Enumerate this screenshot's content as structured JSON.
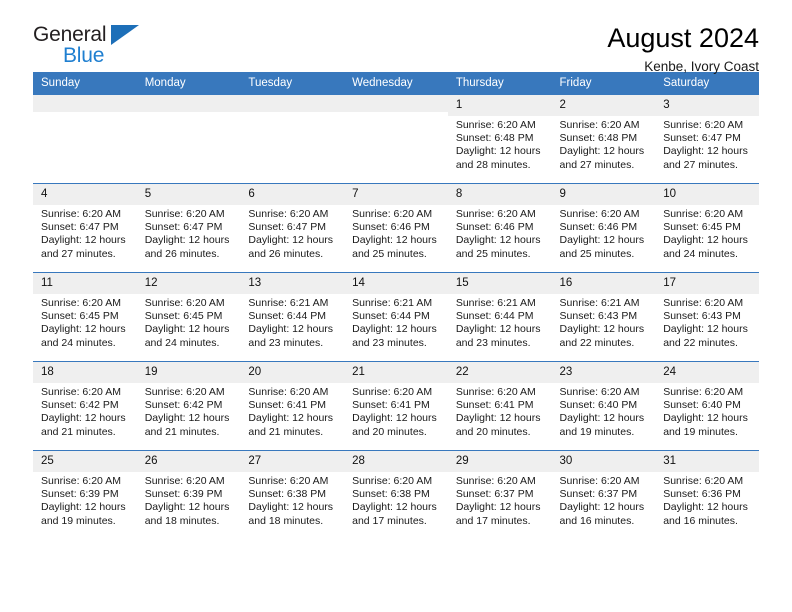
{
  "brand": {
    "line1": "General",
    "line2": "Blue",
    "triangle_color": "#1d6fb8"
  },
  "header": {
    "title": "August 2024",
    "subtitle": "Kenbe, Ivory Coast"
  },
  "colors": {
    "header_blue": "#3878bd",
    "daynum_band": "#efefef",
    "text": "#1a1a1a"
  },
  "weekdays": [
    "Sunday",
    "Monday",
    "Tuesday",
    "Wednesday",
    "Thursday",
    "Friday",
    "Saturday"
  ],
  "labels": {
    "sunrise_prefix": "Sunrise:",
    "sunset_prefix": "Sunset:",
    "daylight_prefix": "Daylight:"
  },
  "weeks": [
    [
      {
        "day": "",
        "empty": true
      },
      {
        "day": "",
        "empty": true
      },
      {
        "day": "",
        "empty": true
      },
      {
        "day": "",
        "empty": true
      },
      {
        "day": "1",
        "l1": "Sunrise: 6:20 AM",
        "l2": "Sunset: 6:48 PM",
        "l3": "Daylight: 12 hours",
        "l4": "and 28 minutes."
      },
      {
        "day": "2",
        "l1": "Sunrise: 6:20 AM",
        "l2": "Sunset: 6:48 PM",
        "l3": "Daylight: 12 hours",
        "l4": "and 27 minutes."
      },
      {
        "day": "3",
        "l1": "Sunrise: 6:20 AM",
        "l2": "Sunset: 6:47 PM",
        "l3": "Daylight: 12 hours",
        "l4": "and 27 minutes."
      }
    ],
    [
      {
        "day": "4",
        "l1": "Sunrise: 6:20 AM",
        "l2": "Sunset: 6:47 PM",
        "l3": "Daylight: 12 hours",
        "l4": "and 27 minutes."
      },
      {
        "day": "5",
        "l1": "Sunrise: 6:20 AM",
        "l2": "Sunset: 6:47 PM",
        "l3": "Daylight: 12 hours",
        "l4": "and 26 minutes."
      },
      {
        "day": "6",
        "l1": "Sunrise: 6:20 AM",
        "l2": "Sunset: 6:47 PM",
        "l3": "Daylight: 12 hours",
        "l4": "and 26 minutes."
      },
      {
        "day": "7",
        "l1": "Sunrise: 6:20 AM",
        "l2": "Sunset: 6:46 PM",
        "l3": "Daylight: 12 hours",
        "l4": "and 25 minutes."
      },
      {
        "day": "8",
        "l1": "Sunrise: 6:20 AM",
        "l2": "Sunset: 6:46 PM",
        "l3": "Daylight: 12 hours",
        "l4": "and 25 minutes."
      },
      {
        "day": "9",
        "l1": "Sunrise: 6:20 AM",
        "l2": "Sunset: 6:46 PM",
        "l3": "Daylight: 12 hours",
        "l4": "and 25 minutes."
      },
      {
        "day": "10",
        "l1": "Sunrise: 6:20 AM",
        "l2": "Sunset: 6:45 PM",
        "l3": "Daylight: 12 hours",
        "l4": "and 24 minutes."
      }
    ],
    [
      {
        "day": "11",
        "l1": "Sunrise: 6:20 AM",
        "l2": "Sunset: 6:45 PM",
        "l3": "Daylight: 12 hours",
        "l4": "and 24 minutes."
      },
      {
        "day": "12",
        "l1": "Sunrise: 6:20 AM",
        "l2": "Sunset: 6:45 PM",
        "l3": "Daylight: 12 hours",
        "l4": "and 24 minutes."
      },
      {
        "day": "13",
        "l1": "Sunrise: 6:21 AM",
        "l2": "Sunset: 6:44 PM",
        "l3": "Daylight: 12 hours",
        "l4": "and 23 minutes."
      },
      {
        "day": "14",
        "l1": "Sunrise: 6:21 AM",
        "l2": "Sunset: 6:44 PM",
        "l3": "Daylight: 12 hours",
        "l4": "and 23 minutes."
      },
      {
        "day": "15",
        "l1": "Sunrise: 6:21 AM",
        "l2": "Sunset: 6:44 PM",
        "l3": "Daylight: 12 hours",
        "l4": "and 23 minutes."
      },
      {
        "day": "16",
        "l1": "Sunrise: 6:21 AM",
        "l2": "Sunset: 6:43 PM",
        "l3": "Daylight: 12 hours",
        "l4": "and 22 minutes."
      },
      {
        "day": "17",
        "l1": "Sunrise: 6:20 AM",
        "l2": "Sunset: 6:43 PM",
        "l3": "Daylight: 12 hours",
        "l4": "and 22 minutes."
      }
    ],
    [
      {
        "day": "18",
        "l1": "Sunrise: 6:20 AM",
        "l2": "Sunset: 6:42 PM",
        "l3": "Daylight: 12 hours",
        "l4": "and 21 minutes."
      },
      {
        "day": "19",
        "l1": "Sunrise: 6:20 AM",
        "l2": "Sunset: 6:42 PM",
        "l3": "Daylight: 12 hours",
        "l4": "and 21 minutes."
      },
      {
        "day": "20",
        "l1": "Sunrise: 6:20 AM",
        "l2": "Sunset: 6:41 PM",
        "l3": "Daylight: 12 hours",
        "l4": "and 21 minutes."
      },
      {
        "day": "21",
        "l1": "Sunrise: 6:20 AM",
        "l2": "Sunset: 6:41 PM",
        "l3": "Daylight: 12 hours",
        "l4": "and 20 minutes."
      },
      {
        "day": "22",
        "l1": "Sunrise: 6:20 AM",
        "l2": "Sunset: 6:41 PM",
        "l3": "Daylight: 12 hours",
        "l4": "and 20 minutes."
      },
      {
        "day": "23",
        "l1": "Sunrise: 6:20 AM",
        "l2": "Sunset: 6:40 PM",
        "l3": "Daylight: 12 hours",
        "l4": "and 19 minutes."
      },
      {
        "day": "24",
        "l1": "Sunrise: 6:20 AM",
        "l2": "Sunset: 6:40 PM",
        "l3": "Daylight: 12 hours",
        "l4": "and 19 minutes."
      }
    ],
    [
      {
        "day": "25",
        "l1": "Sunrise: 6:20 AM",
        "l2": "Sunset: 6:39 PM",
        "l3": "Daylight: 12 hours",
        "l4": "and 19 minutes."
      },
      {
        "day": "26",
        "l1": "Sunrise: 6:20 AM",
        "l2": "Sunset: 6:39 PM",
        "l3": "Daylight: 12 hours",
        "l4": "and 18 minutes."
      },
      {
        "day": "27",
        "l1": "Sunrise: 6:20 AM",
        "l2": "Sunset: 6:38 PM",
        "l3": "Daylight: 12 hours",
        "l4": "and 18 minutes."
      },
      {
        "day": "28",
        "l1": "Sunrise: 6:20 AM",
        "l2": "Sunset: 6:38 PM",
        "l3": "Daylight: 12 hours",
        "l4": "and 17 minutes."
      },
      {
        "day": "29",
        "l1": "Sunrise: 6:20 AM",
        "l2": "Sunset: 6:37 PM",
        "l3": "Daylight: 12 hours",
        "l4": "and 17 minutes."
      },
      {
        "day": "30",
        "l1": "Sunrise: 6:20 AM",
        "l2": "Sunset: 6:37 PM",
        "l3": "Daylight: 12 hours",
        "l4": "and 16 minutes."
      },
      {
        "day": "31",
        "l1": "Sunrise: 6:20 AM",
        "l2": "Sunset: 6:36 PM",
        "l3": "Daylight: 12 hours",
        "l4": "and 16 minutes."
      }
    ]
  ]
}
